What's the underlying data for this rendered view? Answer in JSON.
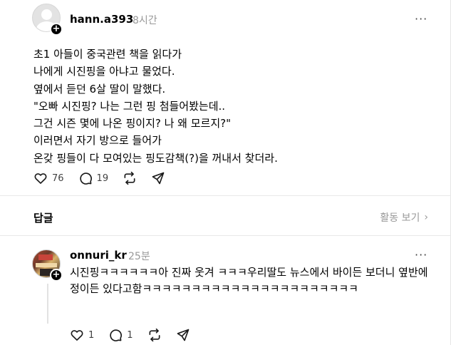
{
  "post": {
    "username": "hann.a393",
    "time": "8시간",
    "more": "···",
    "lines": [
      "초1 아들이 중국관련 책을 읽다가",
      "나에게 시진핑을 아냐고 물었다.",
      "옆에서 듣던 6살 딸이 말했다.",
      "\"오빠 시진핑? 나는 그런 핑 첨들어봤는데..",
      "그건 시즌 몇에 나온 핑이지? 나 왜 모르지?\"",
      "이러면서 자기 방으로 들어가",
      "온갖 핑들이 다 모여있는 핑도감책(?)을 꺼내서 찾더라."
    ],
    "actions": {
      "like_count": "76",
      "comment_count": "19"
    }
  },
  "replies_header": {
    "title": "답글",
    "activity_label": "활동 보기",
    "activity_chevron": "›"
  },
  "comment": {
    "username": "onnuri_kr",
    "time": "25분",
    "more": "···",
    "text": "시진핑ㅋㅋㅋㅋㅋㅋ아 진짜 웃겨 ㅋㅋㅋ우리딸도 뉴스에서 바이든 보더니 옆반에 정이든 있다고함ㅋㅋㅋㅋㅋㅋㅋㅋㅋㅋㅋㅋㅋㅋㅋㅋㅋㅋㅋㅋㅋㅋ",
    "actions": {
      "like_count": "1",
      "comment_count": "1"
    }
  },
  "icons": {
    "follow_plus": "+",
    "like": "heart-icon",
    "comment": "comment-icon",
    "repost": "repost-icon",
    "share": "share-icon"
  }
}
